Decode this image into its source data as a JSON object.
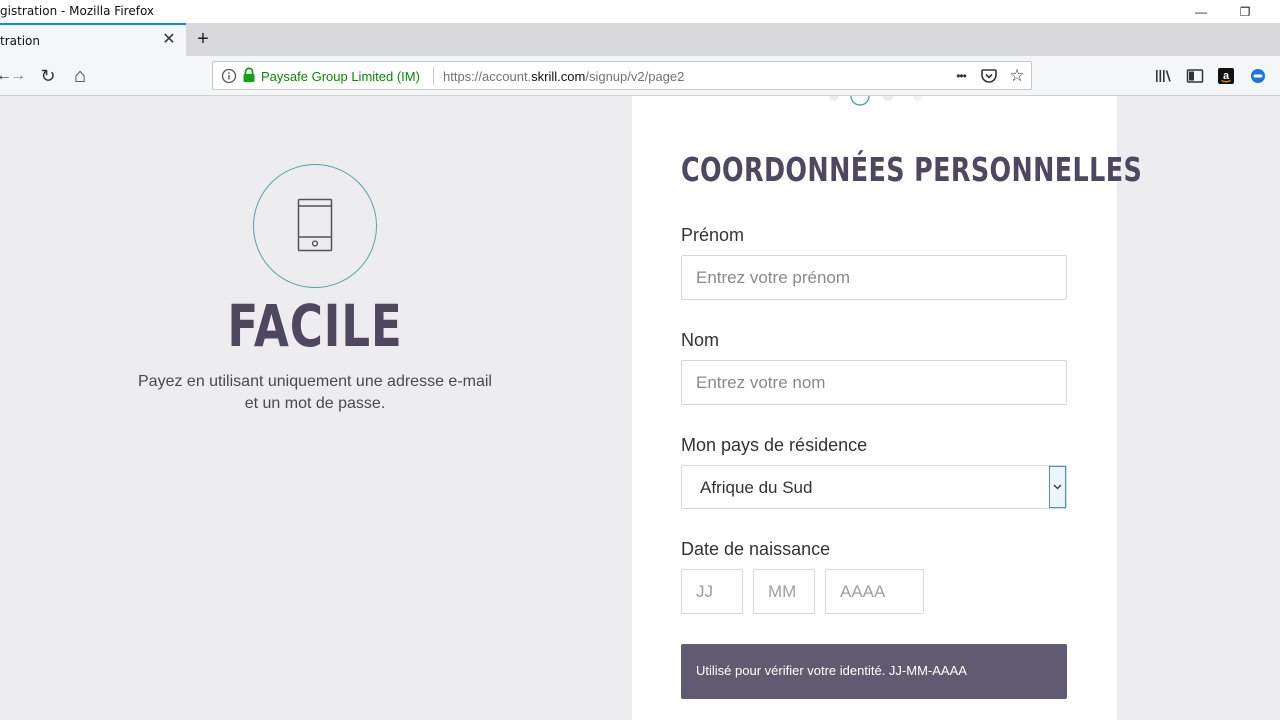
{
  "window": {
    "title": "gistration - Mozilla Firefox",
    "minimize_glyph": "—",
    "restore_glyph": "❐"
  },
  "tabs": [
    {
      "label": "tration",
      "close_glyph": "✕"
    }
  ],
  "new_tab_glyph": "+",
  "nav": {
    "back_glyph": "←",
    "forward_glyph": "→",
    "reload_glyph": "↻",
    "home_glyph": "⌂",
    "identity": "Paysafe Group Limited (IM)",
    "url_prefix": "https://account.",
    "url_host": "skrill.com",
    "url_path": "/signup/v2/page2",
    "page_actions_glyph": "•••",
    "bookmark_glyph": "☆"
  },
  "toolbar_icons": [
    "library-icon",
    "sidebar-icon",
    "amazon-icon",
    "extension-icon"
  ],
  "hero": {
    "icon": "smartphone-icon",
    "title": "FACILE",
    "description": "Payez en utilisant uniquement une adresse e-mail et un mot de passe."
  },
  "form": {
    "title": "COORDONNÉES PERSONNELLES",
    "first_name": {
      "label": "Prénom",
      "placeholder": "Entrez votre prénom",
      "value": ""
    },
    "last_name": {
      "label": "Nom",
      "placeholder": "Entrez votre nom",
      "value": ""
    },
    "country": {
      "label": "Mon pays de résidence",
      "value": "Afrique du Sud"
    },
    "birthdate": {
      "label": "Date de naissance",
      "day_placeholder": "JJ",
      "month_placeholder": "MM",
      "year_placeholder": "AAAA"
    },
    "hint": "Utilisé pour vérifier votre identité. JJ-MM-AAAA"
  },
  "colors": {
    "accent_teal": "#4aa9a8",
    "heading_purple": "#4f4660",
    "hint_bg": "#625a70",
    "secure_green": "#058b00",
    "tab_accent": "#0a84ff"
  }
}
